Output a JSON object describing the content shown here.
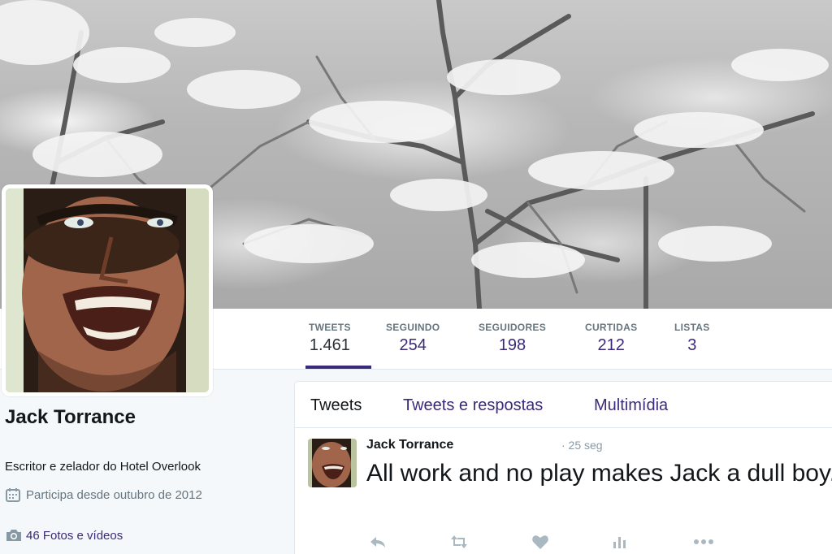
{
  "profile": {
    "name": "Jack Torrance",
    "bio": "Escritor e zelador do Hotel Overlook",
    "joined": "Participa desde outubro de 2012",
    "photos_link": "46 Fotos e vídeos"
  },
  "stats": [
    {
      "label": "TWEETS",
      "value": "1.461"
    },
    {
      "label": "SEGUINDO",
      "value": "254"
    },
    {
      "label": "SEGUIDORES",
      "value": "198"
    },
    {
      "label": "CURTIDAS",
      "value": "212"
    },
    {
      "label": "LISTAS",
      "value": "3"
    }
  ],
  "timeline": {
    "tabs": [
      "Tweets",
      "Tweets e respostas",
      "Multimídia"
    ],
    "tweet": {
      "author": "Jack Torrance",
      "time": "· 25 seg",
      "text": "All work and no play makes Jack a dull boy."
    },
    "actions": [
      "reply-icon",
      "retweet-icon",
      "like-icon",
      "analytics-icon",
      "more-icon"
    ]
  },
  "colors": {
    "accent": "#3b2a7a",
    "background": "#f5f8fa",
    "muted": "#66757f"
  }
}
